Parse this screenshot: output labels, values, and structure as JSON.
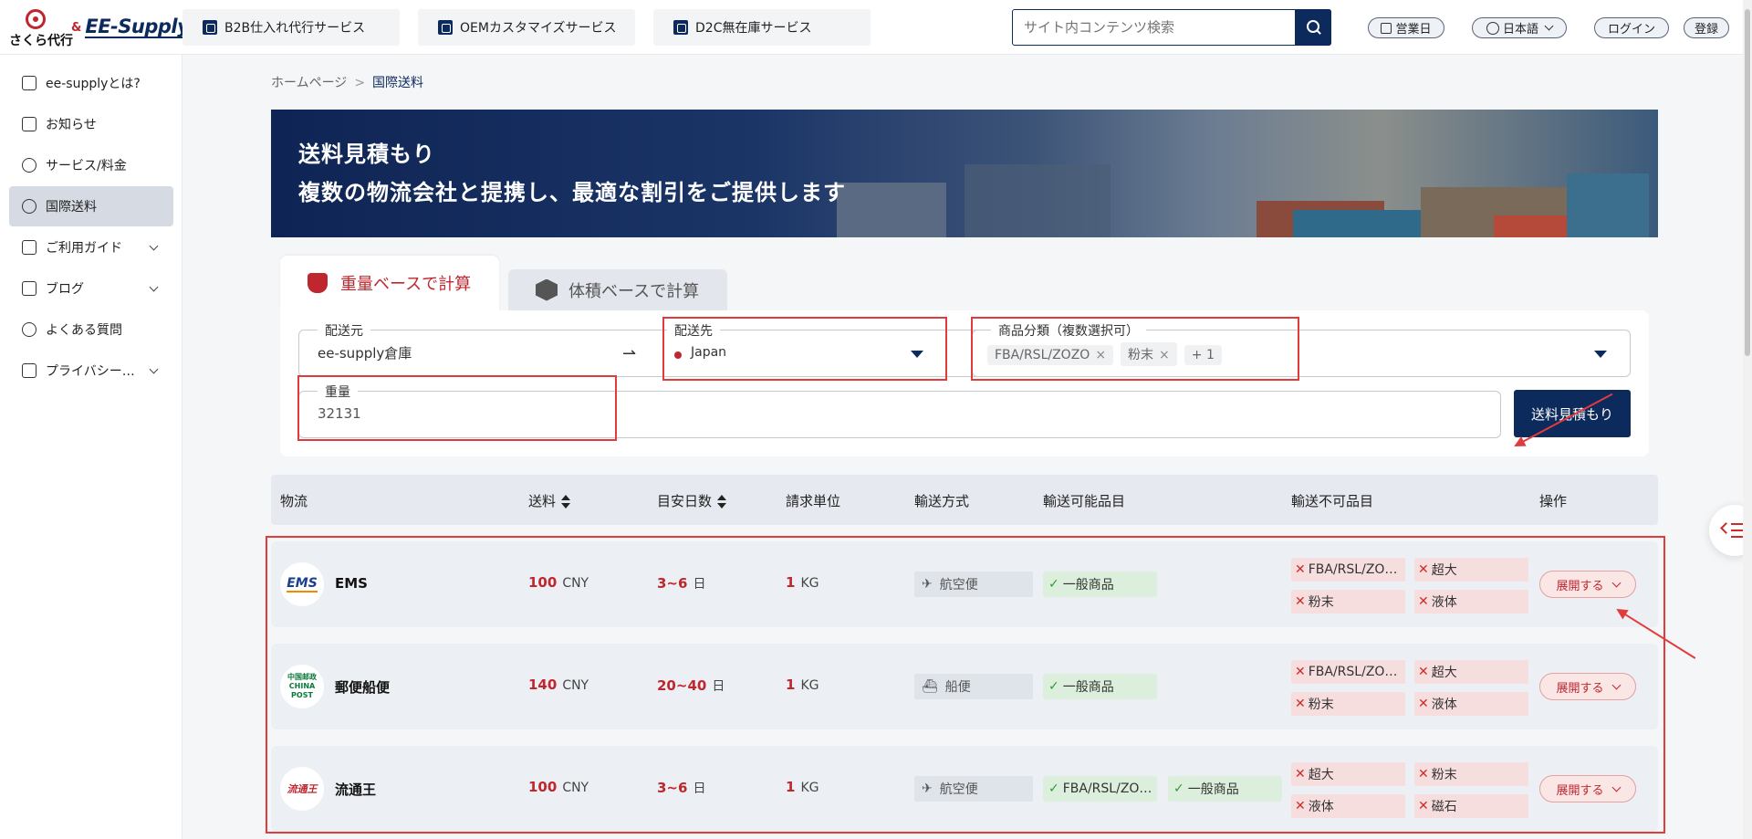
{
  "brand": {
    "sakura": "さくら代行",
    "amp": "&",
    "ee": "EE-Supply"
  },
  "topnav": [
    {
      "label": "B2B仕入れ代行サービス"
    },
    {
      "label": "OEMカスタマイズサービス"
    },
    {
      "label": "D2C無在庫サービス"
    }
  ],
  "search": {
    "placeholder": "サイト内コンテンツ検索"
  },
  "header_pills": {
    "business_day": "営業日",
    "language": "日本語",
    "login": "ログイン",
    "register": "登録"
  },
  "sidebar": {
    "items": [
      {
        "label": "ee-supplyとは?",
        "icon": "home-icon"
      },
      {
        "label": "お知らせ",
        "icon": "megaphone-icon"
      },
      {
        "label": "サービス/料金",
        "icon": "yen-icon"
      },
      {
        "label": "国際送料",
        "icon": "globe-icon",
        "active": true
      },
      {
        "label": "ご利用ガイド",
        "icon": "guide-icon",
        "expandable": true
      },
      {
        "label": "ブログ",
        "icon": "image-icon",
        "expandable": true
      },
      {
        "label": "よくある質問",
        "icon": "shield-icon"
      },
      {
        "label": "プライバシー…",
        "icon": "save-icon",
        "expandable": true
      }
    ]
  },
  "breadcrumb": {
    "home": "ホームページ",
    "sep": ">",
    "current": "国際送料"
  },
  "banner": {
    "line1": "送料見積もり",
    "line2": "複数の物流会社と提携し、最適な割引をご提供します"
  },
  "tabs": {
    "weight": "重量ベースで計算",
    "volume": "体積ベースで計算"
  },
  "form": {
    "origin_label": "配送元",
    "origin_value": "ee-supply倉庫",
    "dest_label": "配送先",
    "dest_value": "Japan",
    "category_label": "商品分類（複数選択可）",
    "chips": [
      "FBA/RSL/ZOZO",
      "粉末"
    ],
    "chip_more": "+ 1",
    "weight_label": "重量",
    "weight_value": "32131",
    "submit": "送料見積もり"
  },
  "table": {
    "headers": {
      "carrier": "物流",
      "price": "送料",
      "days": "目安日数",
      "unit": "請求単位",
      "mode": "輸送方式",
      "ok": "輸送可能品目",
      "ng": "輸送不可品目",
      "ops": "操作"
    },
    "rows": [
      {
        "carrier": "EMS",
        "logo": "EMS",
        "price": "100",
        "currency": "CNY",
        "days": "3~6",
        "day_unit": "日",
        "bill": "1",
        "bill_unit": "KG",
        "mode": "航空便",
        "ok": [
          "一般商品"
        ],
        "ng": [
          "FBA/RSL/ZO…",
          "超大",
          "粉末",
          "液体"
        ],
        "action": "展開する"
      },
      {
        "carrier": "郵便船便",
        "logo": "中国邮政 CHINA POST",
        "price": "140",
        "currency": "CNY",
        "days": "20~40",
        "day_unit": "日",
        "bill": "1",
        "bill_unit": "KG",
        "mode": "船便",
        "ok": [
          "一般商品"
        ],
        "ng": [
          "FBA/RSL/ZO…",
          "超大",
          "粉末",
          "液体"
        ],
        "action": "展開する"
      },
      {
        "carrier": "流通王",
        "logo": "流通王",
        "price": "100",
        "currency": "CNY",
        "days": "3~6",
        "day_unit": "日",
        "bill": "1",
        "bill_unit": "KG",
        "mode": "航空便",
        "ok": [
          "FBA/RSL/ZO…",
          "一般商品"
        ],
        "ng": [
          "超大",
          "粉末",
          "液体",
          "磁石"
        ],
        "action": "展開する"
      }
    ]
  },
  "colors": {
    "navy": "#0d2a5c",
    "accent": "#c0262d",
    "annotation": "#e23b3b"
  }
}
